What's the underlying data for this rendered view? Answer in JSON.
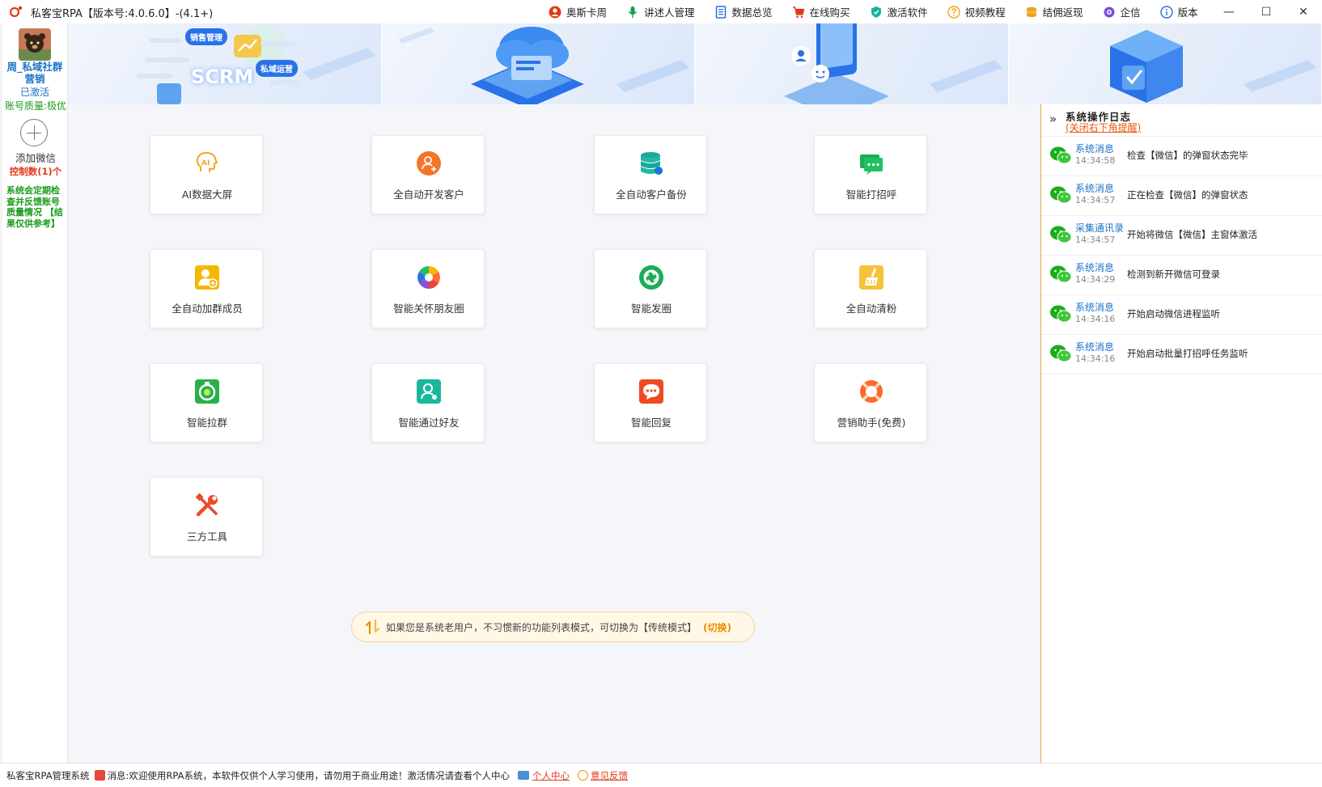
{
  "window": {
    "title": "私客宝RPA【版本号:4.0.6.0】-(4.1+)",
    "controls": [
      "—",
      "☐",
      "✕"
    ]
  },
  "menu": [
    {
      "label": "奥斯卡周",
      "icon": "user-circle-icon",
      "color": "#e03a1a"
    },
    {
      "label": "讲述人管理",
      "icon": "microphone-icon",
      "color": "#1a9a50"
    },
    {
      "label": "数据总览",
      "icon": "document-icon",
      "color": "#2a6fd8"
    },
    {
      "label": "在线购买",
      "icon": "cart-icon",
      "color": "#e03a1a"
    },
    {
      "label": "激活软件",
      "icon": "shield-icon",
      "color": "#1ab0a0"
    },
    {
      "label": "视频教程",
      "icon": "help-icon",
      "color": "#f0a020"
    },
    {
      "label": "结佣返现",
      "icon": "coins-icon",
      "color": "#f0a020"
    },
    {
      "label": "企信",
      "icon": "gear-icon",
      "color": "#7a4fd8"
    },
    {
      "label": "版本",
      "icon": "info-icon",
      "color": "#2a6fd8"
    }
  ],
  "sidebar": {
    "account_name": "周_私域社群营销",
    "status": "已激活",
    "quality": "账号质量:极优",
    "add_wechat": "添加微信",
    "control_count": "控制数(1)个",
    "note": "系统会定期检查并反馈账号质量情况 【结果仅供参考】"
  },
  "banner": {
    "scrm_text": "SCRM",
    "tag_sales": "销售管理",
    "tag_private": "私域运营"
  },
  "features": [
    {
      "label": "AI数据大屏",
      "icon": "ai-brain-icon"
    },
    {
      "label": "全自动开发客户",
      "icon": "add-user-icon"
    },
    {
      "label": "全自动客户备份",
      "icon": "database-icon"
    },
    {
      "label": "智能打招呼",
      "icon": "chat-bubble-icon"
    },
    {
      "label": "全自动加群成员",
      "icon": "group-add-icon"
    },
    {
      "label": "智能关怀朋友圈",
      "icon": "aperture-icon"
    },
    {
      "label": "智能发圈",
      "icon": "moments-icon"
    },
    {
      "label": "全自动清粉",
      "icon": "broom-icon"
    },
    {
      "label": "智能拉群",
      "icon": "timer-icon"
    },
    {
      "label": "智能通过好友",
      "icon": "friend-accept-icon"
    },
    {
      "label": "智能回复",
      "icon": "reply-bubble-icon"
    },
    {
      "label": "营销助手(免费)",
      "icon": "lifebuoy-icon"
    },
    {
      "label": "三方工具",
      "icon": "tools-icon"
    }
  ],
  "switch_bar": {
    "text": "如果您是系统老用户，不习惯新的功能列表模式，可切换为【传统模式】",
    "link": "(切换)"
  },
  "log": {
    "title": "系统操作日志",
    "close_hint": "(关闭右下角提醒)",
    "entries": [
      {
        "category": "系统消息",
        "time": "14:34:58",
        "message": "检查【微信】的弹窗状态完毕"
      },
      {
        "category": "系统消息",
        "time": "14:34:57",
        "message": "正在检查【微信】的弹窗状态"
      },
      {
        "category": "采集通讯录",
        "time": "14:34:57",
        "message": "开始将微信【微信】主窗体激活"
      },
      {
        "category": "系统消息",
        "time": "14:34:29",
        "message": "检测到新开微信可登录"
      },
      {
        "category": "系统消息",
        "time": "14:34:16",
        "message": "开始启动微信进程监听"
      },
      {
        "category": "系统消息",
        "time": "14:34:16",
        "message": "开始启动批量打招呼任务监听"
      }
    ]
  },
  "statusbar": {
    "system": "私客宝RPA管理系统",
    "message": "消息:欢迎使用RPA系统，本软件仅供个人学习使用，请勿用于商业用途！激活情况请查看个人中心",
    "personal_center": "个人中心",
    "feedback": "意见反馈"
  }
}
